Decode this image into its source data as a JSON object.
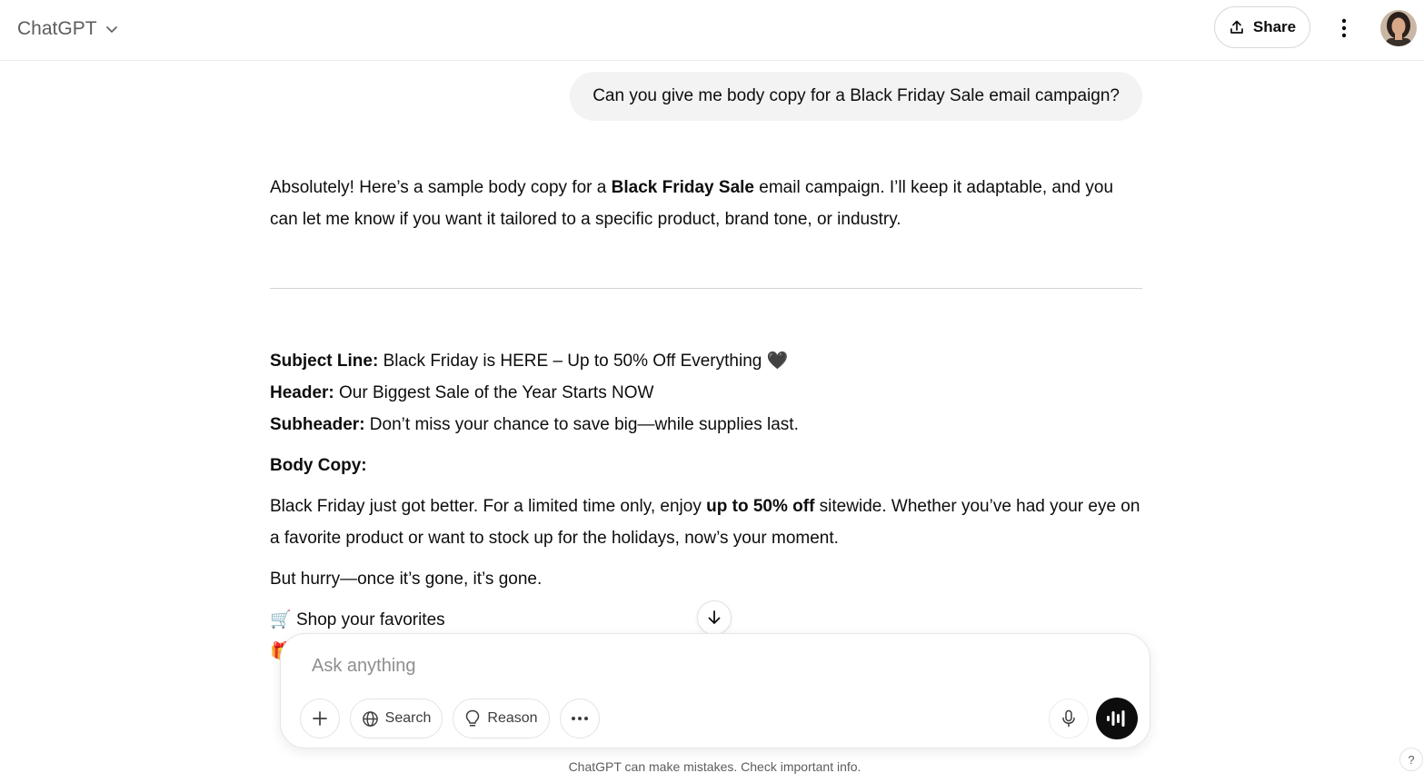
{
  "header": {
    "model_name": "ChatGPT",
    "share_label": "Share"
  },
  "conversation": {
    "user_message": "Can you give me body copy for a Black Friday Sale email campaign?",
    "assistant": {
      "intro_before": "Absolutely! Here’s a sample body copy for a ",
      "intro_bold": "Black Friday Sale",
      "intro_after": " email campaign. I’ll keep it adaptable, and you can let me know if you want it tailored to a specific product, brand tone, or industry.",
      "subject_label": "Subject Line:",
      "subject_value": " Black Friday is HERE – Up to 50% Off Everything ",
      "subject_emoji": "🖤",
      "header_label": "Header:",
      "header_value": " Our Biggest Sale of the Year Starts NOW",
      "subheader_label": "Subheader:",
      "subheader_value": " Don’t miss your chance to save big—while supplies last.",
      "body_copy_label": "Body Copy:",
      "body_p1_before": "Black Friday just got better. For a limited time only, enjoy ",
      "body_p1_bold": "up to 50% off",
      "body_p1_after": " sitewide. Whether you’ve had your eye on a favorite product or want to stock up for the holidays, now’s your moment.",
      "body_p2": "But hurry—once it’s gone, it’s gone.",
      "bullet1_emoji": "🛒",
      "bullet1_text": "Shop your favorites",
      "bullet2_emoji": "🎁"
    }
  },
  "composer": {
    "placeholder": "Ask anything",
    "search_label": "Search",
    "reason_label": "Reason"
  },
  "footer": {
    "disclaimer": "ChatGPT can make mistakes. Check important info.",
    "help_label": "?"
  },
  "icons": {
    "model_dropdown": "chevron-down-icon",
    "share": "upload-icon",
    "menu": "kebab-icon",
    "scroll": "arrow-down-icon",
    "attach": "plus-icon",
    "search": "globe-icon",
    "reason": "lightbulb-icon",
    "more": "ellipsis-icon",
    "mic": "microphone-icon",
    "voice": "voice-mode-icon"
  }
}
